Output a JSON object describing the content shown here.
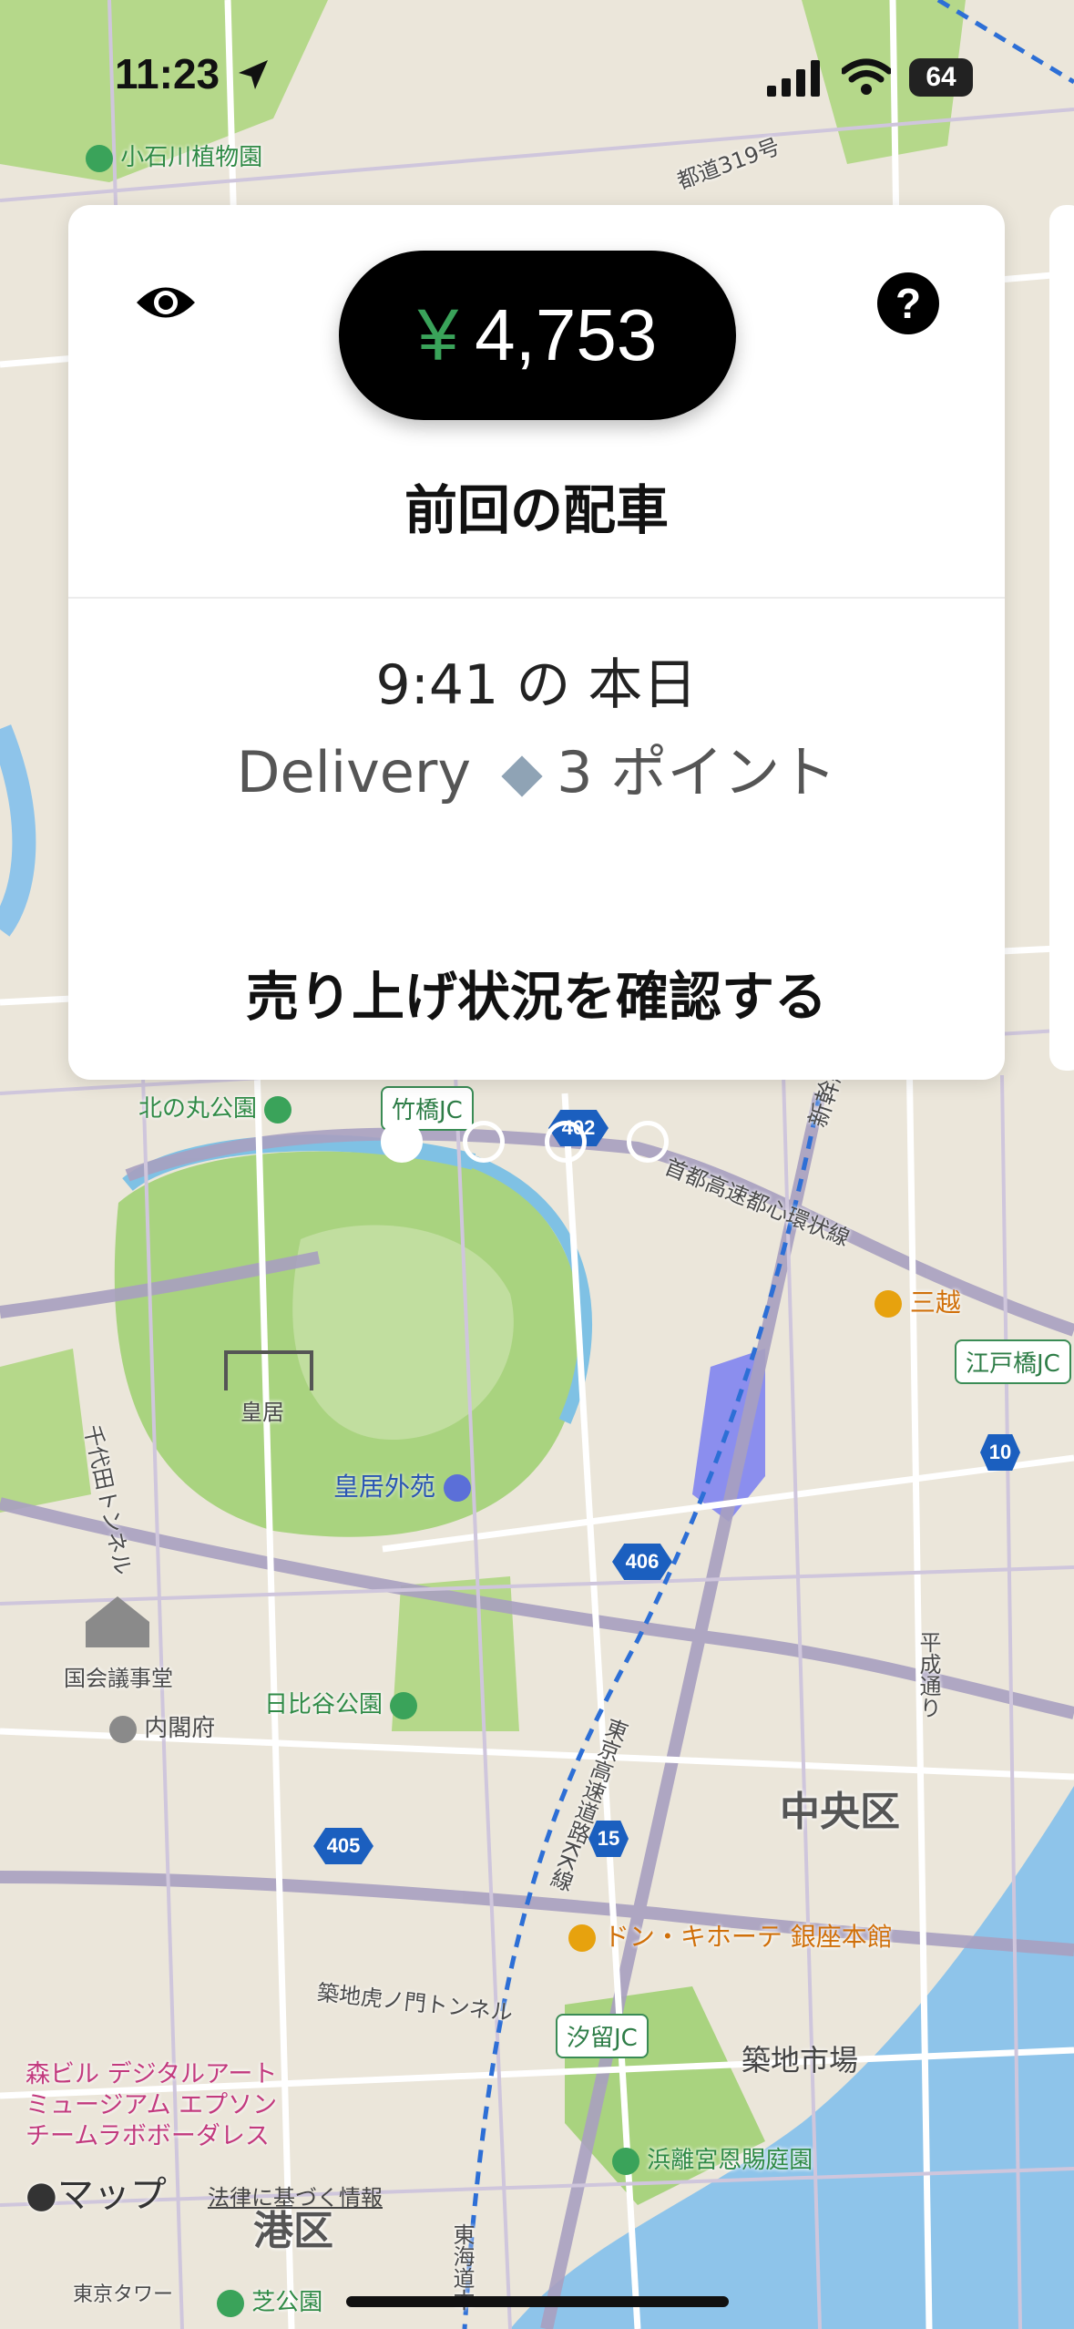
{
  "status_bar": {
    "time": "11:23",
    "battery": "64"
  },
  "card": {
    "amount_currency": "¥",
    "amount": "4,753",
    "title": "前回の配車",
    "ride_time": "9:41 の 本日",
    "ride_type": "Delivery",
    "points": "3 ポイント",
    "earnings_link": "売り上げ状況を確認する"
  },
  "pager": {
    "count": 4,
    "active_index": 0
  },
  "map": {
    "labels": {
      "koishikawa": "小石川植物園",
      "kitanomaru": "北の丸公園",
      "takebashi_jc": "竹橋JC",
      "route_319": "都道319号",
      "shuto_ring": "首都高速都心環状線",
      "shinkansen": "新幹線",
      "mitsukoshi": "三越",
      "edobashi_jc": "江戸橋JC",
      "kokyo": "皇居",
      "kokyo_gaien": "皇居外苑",
      "chiyoda_tunnel": "千代田トンネル",
      "diet": "国会議事堂",
      "cabinet": "内閣府",
      "hibiya": "日比谷公園",
      "chuo": "中央区",
      "heisei": "平成通り",
      "tokyo_expressway": "東京高速道路KK線",
      "donki": "ドン・キホーテ 銀座本館",
      "toranomon_tunnel": "築地虎ノ門トンネル",
      "shiodome_jc": "汐留JC",
      "tsukiji": "築地市場",
      "mori": "森ビル デジタルアート\nミュージアム エプソン\nチームラボボーダレス",
      "hamarikyu": "浜離宮恩賜庭園",
      "minato": "港区",
      "tokyo_tower": "東京タワー",
      "shiba": "芝公園",
      "tokaido": "東海道本",
      "apple_maps": "マップ",
      "legal": "法律に基づく情報"
    },
    "routes": [
      "402",
      "406",
      "405",
      "15",
      "10"
    ]
  }
}
